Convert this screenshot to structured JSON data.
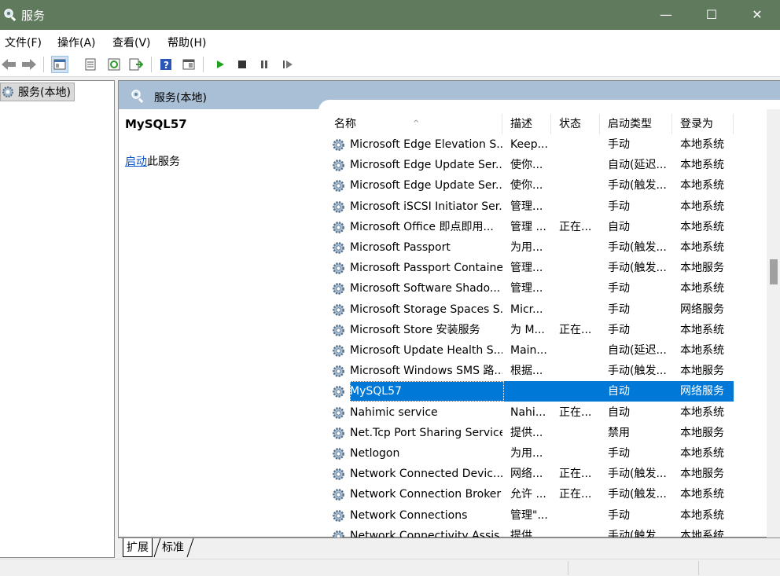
{
  "window": {
    "title": "服务",
    "minimize": "—",
    "maximize": "☐",
    "close": "✕"
  },
  "menu": [
    "文件(F)",
    "操作(A)",
    "查看(V)",
    "帮助(H)"
  ],
  "tree": {
    "root_label": "服务(本地)"
  },
  "content": {
    "header_label": "服务(本地)",
    "selected_service_name": "MySQL57",
    "start_link": "启动",
    "start_suffix": "此服务"
  },
  "columns": {
    "name": "名称",
    "description": "描述",
    "status": "状态",
    "startup": "启动类型",
    "logon": "登录为"
  },
  "services": [
    {
      "name": "Microsoft Edge Elevation S...",
      "description": "Keep...",
      "status": "",
      "startup": "手动",
      "logon": "本地系统"
    },
    {
      "name": "Microsoft Edge Update Ser...",
      "description": "使你...",
      "status": "",
      "startup": "自动(延迟...",
      "logon": "本地系统"
    },
    {
      "name": "Microsoft Edge Update Ser...",
      "description": "使你...",
      "status": "",
      "startup": "手动(触发...",
      "logon": "本地系统"
    },
    {
      "name": "Microsoft iSCSI Initiator Ser...",
      "description": "管理...",
      "status": "",
      "startup": "手动",
      "logon": "本地系统"
    },
    {
      "name": "Microsoft Office 即点即用...",
      "description": "管理 ...",
      "status": "正在...",
      "startup": "自动",
      "logon": "本地系统"
    },
    {
      "name": "Microsoft Passport",
      "description": "为用...",
      "status": "",
      "startup": "手动(触发...",
      "logon": "本地系统"
    },
    {
      "name": "Microsoft Passport Container",
      "description": "管理...",
      "status": "",
      "startup": "手动(触发...",
      "logon": "本地服务"
    },
    {
      "name": "Microsoft Software Shado...",
      "description": "管理...",
      "status": "",
      "startup": "手动",
      "logon": "本地系统"
    },
    {
      "name": "Microsoft Storage Spaces S...",
      "description": "Micr...",
      "status": "",
      "startup": "手动",
      "logon": "网络服务"
    },
    {
      "name": "Microsoft Store 安装服务",
      "description": "为 M...",
      "status": "正在...",
      "startup": "手动",
      "logon": "本地系统"
    },
    {
      "name": "Microsoft Update Health S...",
      "description": "Main...",
      "status": "",
      "startup": "自动(延迟...",
      "logon": "本地系统"
    },
    {
      "name": "Microsoft Windows SMS 路...",
      "description": "根据...",
      "status": "",
      "startup": "手动(触发...",
      "logon": "本地服务"
    },
    {
      "name": "MySQL57",
      "description": "",
      "status": "",
      "startup": "自动",
      "logon": "网络服务",
      "selected": true
    },
    {
      "name": "Nahimic service",
      "description": "Nahi...",
      "status": "正在...",
      "startup": "自动",
      "logon": "本地系统"
    },
    {
      "name": "Net.Tcp Port Sharing Service",
      "description": "提供...",
      "status": "",
      "startup": "禁用",
      "logon": "本地服务"
    },
    {
      "name": "Netlogon",
      "description": "为用...",
      "status": "",
      "startup": "手动",
      "logon": "本地系统"
    },
    {
      "name": "Network Connected Devic...",
      "description": "网络...",
      "status": "正在...",
      "startup": "手动(触发...",
      "logon": "本地服务"
    },
    {
      "name": "Network Connection Broker",
      "description": "允许 ...",
      "status": "正在...",
      "startup": "手动(触发...",
      "logon": "本地系统"
    },
    {
      "name": "Network Connections",
      "description": "管理\"...",
      "status": "",
      "startup": "手动",
      "logon": "本地系统"
    },
    {
      "name": "Network Connectivity Assis...",
      "description": "提供...",
      "status": "",
      "startup": "手动(触发...",
      "logon": "本地系统"
    }
  ],
  "tabs": [
    "扩展",
    "标准"
  ],
  "colors": {
    "titlebar": "#5f7a5c",
    "header": "#a9bfd6",
    "selection": "#0078d7",
    "link": "#0a51c9"
  }
}
